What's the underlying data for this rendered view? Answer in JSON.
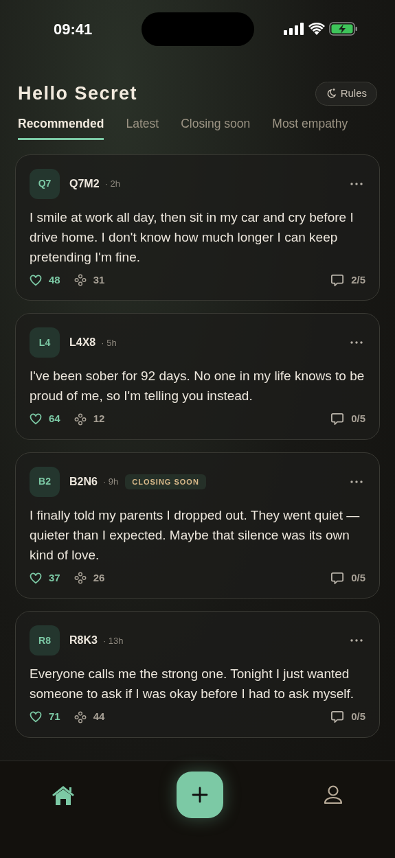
{
  "status_bar": {
    "time": "09:41"
  },
  "header": {
    "title": "Hello Secret",
    "rules_button": "Rules"
  },
  "tabs": [
    {
      "label": "Recommended",
      "selected": true
    },
    {
      "label": "Latest",
      "selected": false
    },
    {
      "label": "Closing soon",
      "selected": false
    },
    {
      "label": "Most empathy",
      "selected": false
    }
  ],
  "posts": [
    {
      "avatar": "Q7",
      "author": "Q7M2",
      "time": "· 2h",
      "text": "I smile at work all day, then sit in my car and cry before I drive home. I don't know how much longer I can keep pretending I'm fine.",
      "likes": "48",
      "hugs": "31",
      "replies": "2/5"
    },
    {
      "avatar": "L4",
      "author": "L4X8",
      "time": "· 5h",
      "text": "I've been sober for 92 days. No one in my life knows to be proud of me, so I'm telling you instead.",
      "likes": "64",
      "hugs": "12",
      "replies": "0/5"
    },
    {
      "avatar": "B2",
      "author": "B2N6",
      "time": "· 9h",
      "badge": "CLOSING SOON",
      "text": "I finally told my parents I dropped out. They went quiet — quieter than I expected. Maybe that silence was its own kind of love.",
      "likes": "37",
      "hugs": "26",
      "replies": "0/5"
    },
    {
      "avatar": "R8",
      "author": "R8K3",
      "time": "· 13h",
      "text": "Everyone calls me the strong one. Tonight I just wanted someone to ask if I was okay before I had to ask myself.",
      "likes": "71",
      "hugs": "44",
      "replies": "0/5"
    }
  ],
  "bottom_nav": [
    {
      "kind": "home",
      "selected": true
    },
    {
      "kind": "add",
      "selected": false
    },
    {
      "kind": "profile",
      "selected": false
    }
  ]
}
